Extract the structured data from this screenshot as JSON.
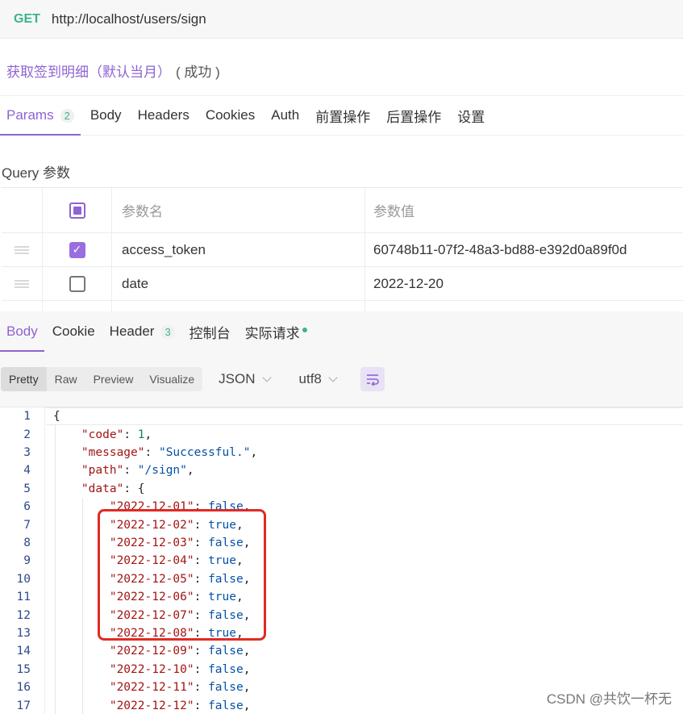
{
  "request": {
    "method": "GET",
    "url": "http://localhost/users/sign",
    "name": "获取签到明细（默认当月）",
    "status": "( 成功 )"
  },
  "request_tabs": [
    {
      "label": "Params",
      "badge": "2"
    },
    {
      "label": "Body"
    },
    {
      "label": "Headers"
    },
    {
      "label": "Cookies"
    },
    {
      "label": "Auth"
    },
    {
      "label": "前置操作"
    },
    {
      "label": "后置操作"
    },
    {
      "label": "设置"
    }
  ],
  "query": {
    "label": "Query 参数",
    "header": {
      "name": "参数名",
      "value": "参数值"
    },
    "rows": [
      {
        "name": "access_token",
        "value": "60748b11-07f2-48a3-bd88-e392d0a89f0d",
        "checked": true
      },
      {
        "name": "date",
        "value": "2022-12-20",
        "checked": false
      }
    ]
  },
  "response_tabs": [
    {
      "label": "Body"
    },
    {
      "label": "Cookie"
    },
    {
      "label": "Header",
      "badge": "3"
    },
    {
      "label": "控制台"
    },
    {
      "label": "实际请求"
    }
  ],
  "view_modes": [
    "Pretty",
    "Raw",
    "Preview",
    "Visualize"
  ],
  "format": "JSON",
  "encoding": "utf8",
  "code_lines": [
    {
      "num": "1",
      "text": "{"
    },
    {
      "num": "2",
      "text": "    \"code\": 1,"
    },
    {
      "num": "3",
      "text": "    \"message\": \"Successful.\","
    },
    {
      "num": "4",
      "text": "    \"path\": \"/sign\","
    },
    {
      "num": "5",
      "text": "    \"data\": {"
    },
    {
      "num": "6",
      "text": "        \"2022-12-01\": false,"
    },
    {
      "num": "7",
      "text": "        \"2022-12-02\": true,"
    },
    {
      "num": "8",
      "text": "        \"2022-12-03\": false,"
    },
    {
      "num": "9",
      "text": "        \"2022-12-04\": true,"
    },
    {
      "num": "10",
      "text": "        \"2022-12-05\": false,"
    },
    {
      "num": "11",
      "text": "        \"2022-12-06\": true,"
    },
    {
      "num": "12",
      "text": "        \"2022-12-07\": false,"
    },
    {
      "num": "13",
      "text": "        \"2022-12-08\": true,"
    },
    {
      "num": "14",
      "text": "        \"2022-12-09\": false,"
    },
    {
      "num": "15",
      "text": "        \"2022-12-10\": false,"
    },
    {
      "num": "16",
      "text": "        \"2022-12-11\": false,"
    },
    {
      "num": "17",
      "text": "        \"2022-12-12\": false,"
    }
  ],
  "watermark": "CSDN @共饮一杯无",
  "colors": {
    "accent": "#8e63d2",
    "method": "#3bb587",
    "highlight_box": "#e02a25"
  }
}
